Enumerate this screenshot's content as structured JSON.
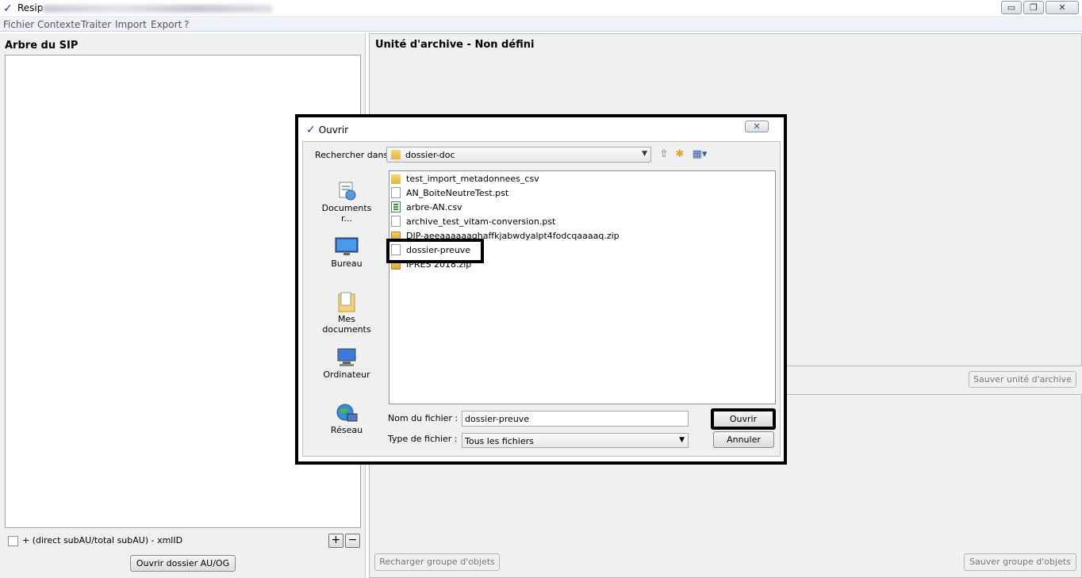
{
  "app": {
    "title": "Resip",
    "window_controls": {
      "minimize": "▭",
      "maximize": "❐",
      "close": "✕"
    }
  },
  "menu": [
    "Fichier",
    "Contexte",
    "Traiter",
    "Import",
    "Export",
    "?"
  ],
  "left_pane": {
    "title": "Arbre du SIP",
    "checkbox_label": "+ (direct subAU/total subAU) - xmlID",
    "add_glyph": "+",
    "remove_glyph": "−",
    "open_button": "Ouvrir dossier AU/OG"
  },
  "right_pane": {
    "title": "Unité d'archive - Non défini",
    "save_unit_button": "Sauver unité d'archive",
    "reload_group_button": "Recharger groupe d'objets",
    "save_group_button": "Sauver groupe d'objets"
  },
  "dialog": {
    "title": "Ouvrir",
    "close_glyph": "✕",
    "look_in_label": "Rechercher dans :",
    "look_in_value": "dossier-doc",
    "places": [
      {
        "label": "Documents r...",
        "icon": "recent-documents-icon"
      },
      {
        "label": "Bureau",
        "icon": "desktop-icon"
      },
      {
        "label": "Mes documents",
        "icon": "my-documents-icon"
      },
      {
        "label": "Ordinateur",
        "icon": "computer-icon"
      },
      {
        "label": "Réseau",
        "icon": "network-icon"
      }
    ],
    "files": [
      {
        "name": "test_import_metadonnees_csv",
        "type": "folder"
      },
      {
        "name": "AN_BoiteNeutreTest.pst",
        "type": "doc"
      },
      {
        "name": "arbre-AN.csv",
        "type": "csv"
      },
      {
        "name": "archive_test_vitam-conversion.pst",
        "type": "doc"
      },
      {
        "name": "DIP-aeeaaaaaaghaffkjabwdyalpt4fodcqaaaaq.zip",
        "type": "zip"
      },
      {
        "name": "dossier-preuve",
        "type": "doc"
      },
      {
        "name": "IPRES 2018.zip",
        "type": "zip"
      }
    ],
    "selected_file": "dossier-preuve",
    "filename_label": "Nom du fichier :",
    "filename_value": "dossier-preuve",
    "filetype_label": "Type de fichier :",
    "filetype_value": "Tous les fichiers",
    "open_button": "Ouvrir",
    "cancel_button": "Annuler"
  }
}
